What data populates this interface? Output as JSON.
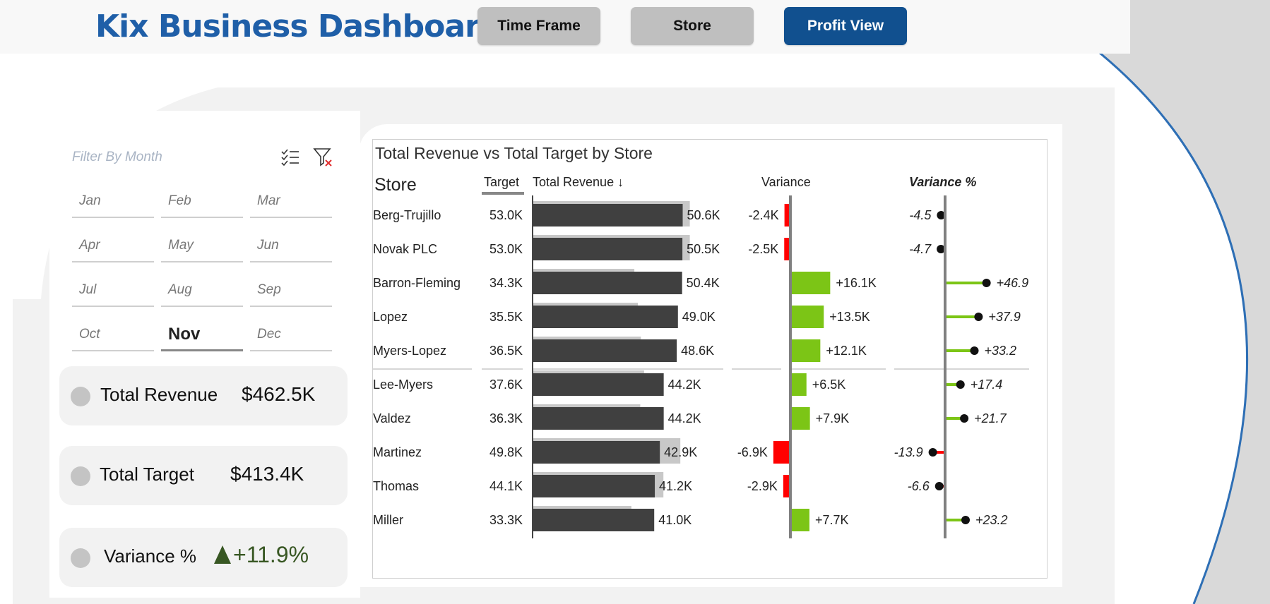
{
  "header": {
    "title": "Kix Business Dashboard",
    "nav": [
      "Time Frame",
      "Store",
      "Profit View"
    ]
  },
  "filter": {
    "label": "Filter By Month",
    "months": [
      "Jan",
      "Feb",
      "Mar",
      "Apr",
      "May",
      "Jun",
      "Jul",
      "Aug",
      "Sep",
      "Oct",
      "Nov",
      "Dec"
    ],
    "selected": "Nov",
    "icons": [
      "select-all-icon",
      "clear-filter-icon"
    ]
  },
  "kpis": {
    "revenue_label": "Total Revenue",
    "revenue_value": "$462.5K",
    "target_label": "Total Target",
    "target_value": "$413.4K",
    "variance_label": "Variance %",
    "variance_value": "+11.9%"
  },
  "colors": {
    "brand": "#1f5fa8",
    "active_nav": "#11508f",
    "bar": "#404040",
    "target_bar": "#c8c8c8",
    "positive": "#7cc516",
    "negative": "#ff0000",
    "kpi_positive": "#385723"
  },
  "chart_data": {
    "type": "table",
    "title": "Total Revenue vs Total Target by Store",
    "columns": [
      "Store",
      "Target",
      "Total Revenue ↓",
      "Variance",
      "Variance %"
    ],
    "rows": [
      {
        "store": "Berg-Trujillo",
        "target": 53.0,
        "target_label": "53.0K",
        "revenue": 50.6,
        "revenue_label": "50.6K",
        "variance": -2.4,
        "variance_label": "-2.4K",
        "variance_pct": -4.5,
        "variance_pct_label": "-4.5"
      },
      {
        "store": "Novak PLC",
        "target": 53.0,
        "target_label": "53.0K",
        "revenue": 50.5,
        "revenue_label": "50.5K",
        "variance": -2.5,
        "variance_label": "-2.5K",
        "variance_pct": -4.7,
        "variance_pct_label": "-4.7"
      },
      {
        "store": "Barron-Fleming",
        "target": 34.3,
        "target_label": "34.3K",
        "revenue": 50.4,
        "revenue_label": "50.4K",
        "variance": 16.1,
        "variance_label": "+16.1K",
        "variance_pct": 46.9,
        "variance_pct_label": "+46.9"
      },
      {
        "store": "Lopez",
        "target": 35.5,
        "target_label": "35.5K",
        "revenue": 49.0,
        "revenue_label": "49.0K",
        "variance": 13.5,
        "variance_label": "+13.5K",
        "variance_pct": 37.9,
        "variance_pct_label": "+37.9"
      },
      {
        "store": "Myers-Lopez",
        "target": 36.5,
        "target_label": "36.5K",
        "revenue": 48.6,
        "revenue_label": "48.6K",
        "variance": 12.1,
        "variance_label": "+12.1K",
        "variance_pct": 33.2,
        "variance_pct_label": "+33.2"
      },
      {
        "store": "Lee-Myers",
        "target": 37.6,
        "target_label": "37.6K",
        "revenue": 44.2,
        "revenue_label": "44.2K",
        "variance": 6.5,
        "variance_label": "+6.5K",
        "variance_pct": 17.4,
        "variance_pct_label": "+17.4"
      },
      {
        "store": "Valdez",
        "target": 36.3,
        "target_label": "36.3K",
        "revenue": 44.2,
        "revenue_label": "44.2K",
        "variance": 7.9,
        "variance_label": "+7.9K",
        "variance_pct": 21.7,
        "variance_pct_label": "+21.7"
      },
      {
        "store": "Martinez",
        "target": 49.8,
        "target_label": "49.8K",
        "revenue": 42.9,
        "revenue_label": "42.9K",
        "variance": -6.9,
        "variance_label": "-6.9K",
        "variance_pct": -13.9,
        "variance_pct_label": "-13.9"
      },
      {
        "store": "Thomas",
        "target": 44.1,
        "target_label": "44.1K",
        "revenue": 41.2,
        "revenue_label": "41.2K",
        "variance": -2.9,
        "variance_label": "-2.9K",
        "variance_pct": -6.6,
        "variance_pct_label": "-6.6"
      },
      {
        "store": "Miller",
        "target": 33.3,
        "target_label": "33.3K",
        "revenue": 41.0,
        "revenue_label": "41.0K",
        "variance": 7.7,
        "variance_label": "+7.7K",
        "variance_pct": 23.2,
        "variance_pct_label": "+23.2"
      }
    ]
  }
}
